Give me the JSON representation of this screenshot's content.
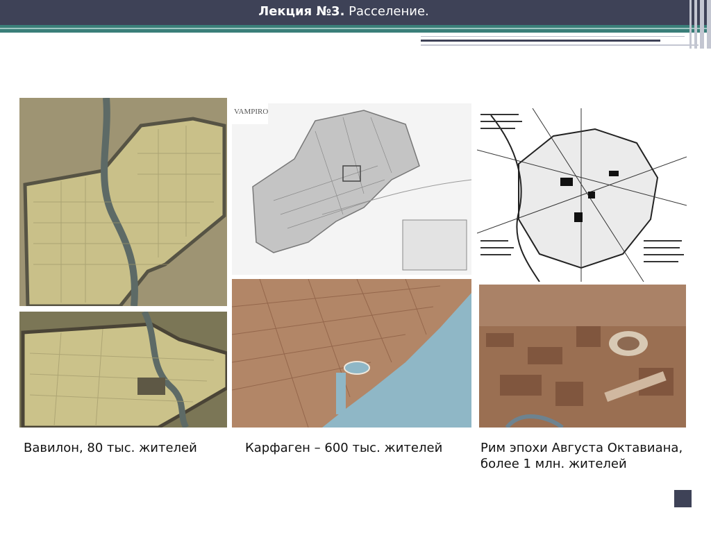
{
  "header": {
    "title_bold": "Лекция №3.",
    "title_rest": "Расселение.",
    "bg_color": "#3e4257",
    "band_color": "#3a7f79"
  },
  "images": {
    "babylon_overhead": {
      "kind": "map",
      "tone": "#a99f7b"
    },
    "babylon_aerial": {
      "kind": "photo",
      "tone": "#b9b07e"
    },
    "carthage_plan": {
      "kind": "map",
      "tone": "#cfcfcf",
      "stamp": "VAMPIRO"
    },
    "carthage_aerial": {
      "kind": "photo",
      "tone": "#b28667"
    },
    "rome_plan": {
      "kind": "map",
      "tone": "#f2f2f2"
    },
    "rome_model": {
      "kind": "photo",
      "tone": "#9a6f52"
    }
  },
  "captions": {
    "babylon": "Вавилон, 80 тыс. жителей",
    "carthage": "Карфаген – 600 тыс. жителей",
    "rome_line1": "Рим эпохи Августа Октавиана,",
    "rome_line2": "более 1 млн. жителей"
  }
}
